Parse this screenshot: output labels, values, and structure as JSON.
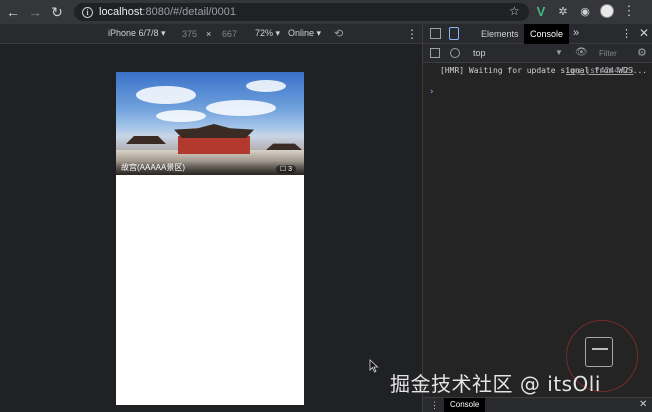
{
  "browser": {
    "url_host": "localhost",
    "url_rest": ":8080/#/detail/0001",
    "icons": [
      "back-arrow",
      "forward-arrow",
      "reload",
      "info",
      "star",
      "vue-devtools",
      "extension",
      "extension",
      "profile",
      "menu"
    ]
  },
  "device_toolbar": {
    "device": "iPhone 6/7/8 ▾",
    "width": "375",
    "times": "×",
    "height": "667",
    "zoom": "72% ▾",
    "network": "Online ▾",
    "more": "⋮"
  },
  "page": {
    "hero_caption": "故宫(AAAAA景区)",
    "photo_count": "☐ 3"
  },
  "devtools": {
    "tabs": [
      "Elements",
      "Console"
    ],
    "active_tab": "Console",
    "more_tabs": "»",
    "context": "top",
    "filter_placeholder": "Filter",
    "log_text": "[HMR] Waiting for update signal from WDS...",
    "log_source": "log.js?4244:23",
    "prompt": "›",
    "drawer_tab": "Console"
  },
  "watermark": "掘金技术社区 @ itsOli",
  "colors": {
    "chrome_bg": "#35363a",
    "devtools_bg": "#242424",
    "vue_green": "#42b883",
    "link_blue": "#8ab4f8"
  }
}
